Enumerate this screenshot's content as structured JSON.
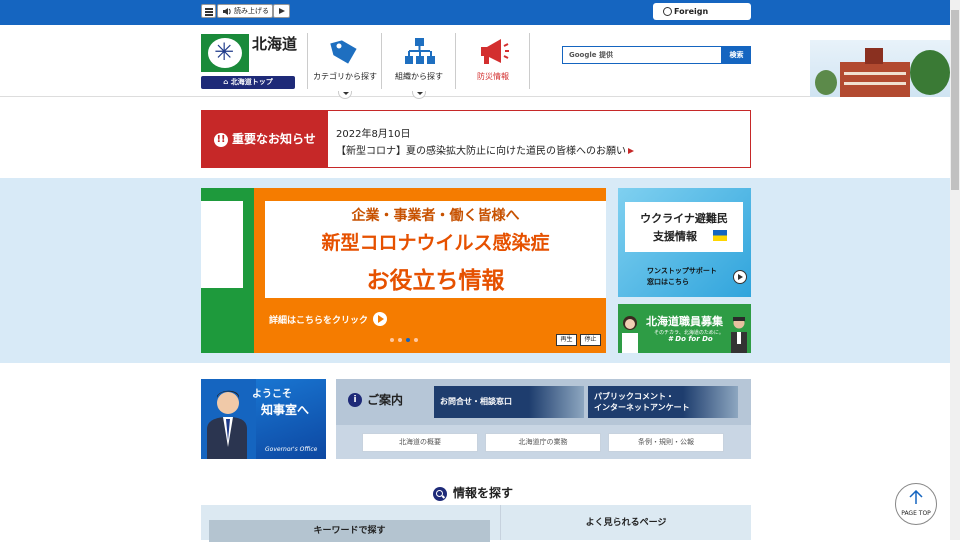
{
  "topbar": {
    "read_aloud_label": "読み上げる",
    "foreign_language_label": "Foreign Language"
  },
  "header": {
    "logo_text": "北海道",
    "home_label": "北海道トップ",
    "nav": [
      {
        "label": "カテゴリから探す",
        "icon": "tag-icon",
        "color": "#1e6fc0"
      },
      {
        "label": "組織から探す",
        "icon": "org-chart-icon",
        "color": "#1e6fc0"
      },
      {
        "label": "防災情報",
        "icon": "megaphone-icon",
        "color": "#d32f2f"
      }
    ],
    "search_placeholder": "Google 提供",
    "search_button": "検索"
  },
  "notice": {
    "label": "重要なお知らせ",
    "date": "2022年8月10日",
    "title": "【新型コロナ】夏の感染拡大防止に向けた道民の皆様へのお願い"
  },
  "banner": {
    "line1": "企業・事業者・働く皆様へ",
    "line2": "新型コロナウイルス感染症",
    "line3": "お役立ち情報",
    "cta": "詳細はこちらをクリック",
    "play_label": "再生",
    "stop_label": "停止",
    "active_slide": 3,
    "slide_count": 4
  },
  "ukraine": {
    "title_line1": "ウクライナ避難民",
    "title_line2": "支援情報",
    "sub": "ワンストップサポート\n窓口はこちら"
  },
  "recruit": {
    "title": "北海道職員募集",
    "sub": "そのチカラ、北海道のために。",
    "tag": "# Do for Do"
  },
  "governor": {
    "line1": "ようこそ",
    "line2": "知事室へ",
    "sub": "Governor's Office"
  },
  "guide": {
    "title": "ご案内",
    "buttons": [
      {
        "label": "お問合せ・相談窓口"
      },
      {
        "label": "パブリックコメント・\nインターネットアンケート"
      }
    ],
    "links": [
      "北海道の概要",
      "北海道庁の業務",
      "条例・規則・公報"
    ]
  },
  "find": {
    "title": "情報を探す",
    "keyword_tab": "キーワードで探す",
    "faq_tab": "よく見られるページ"
  },
  "page_top_label": "PAGE TOP"
}
